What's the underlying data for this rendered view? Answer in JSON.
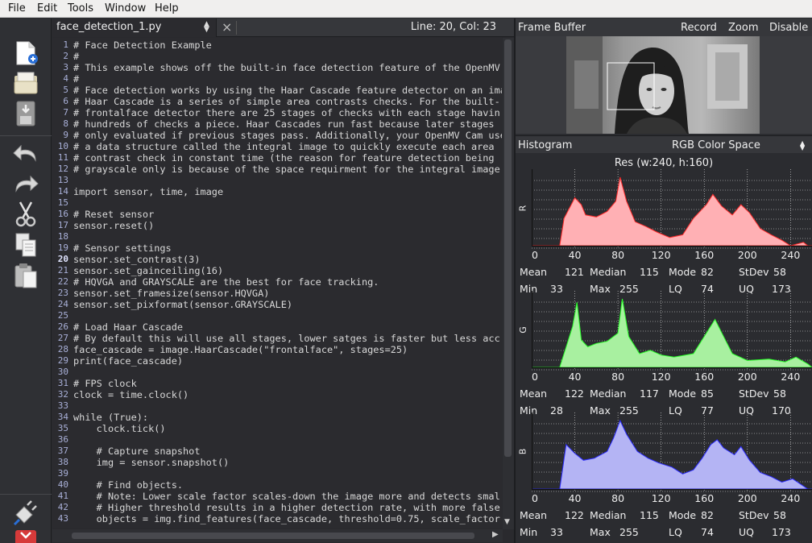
{
  "menu": [
    "File",
    "Edit",
    "Tools",
    "Window",
    "Help"
  ],
  "editor": {
    "filename": "face_detection_1.py",
    "cursor": "Line: 20, Col: 23",
    "current_line": 20,
    "lines": [
      "# Face Detection Example",
      "#",
      "# This example shows off the built-in face detection feature of the OpenMV",
      "#",
      "# Face detection works by using the Haar Cascade feature detector on an ima",
      "# Haar Cascade is a series of simple area contrasts checks. For the built-",
      "# frontalface detector there are 25 stages of checks with each stage havin",
      "# hundreds of checks a piece. Haar Cascades run fast because later stages",
      "# only evaluated if previous stages pass. Additionally, your OpenMV Cam use",
      "# a data structure called the integral image to quickly execute each area",
      "# contrast check in constant time (the reason for feature detection being",
      "# grayscale only is because of the space requirment for the integral image",
      "",
      "import sensor, time, image",
      "",
      "# Reset sensor",
      "sensor.reset()",
      "",
      "# Sensor settings",
      "sensor.set_contrast(3)",
      "sensor.set_gainceiling(16)",
      "# HQVGA and GRAYSCALE are the best for face tracking.",
      "sensor.set_framesize(sensor.HQVGA)",
      "sensor.set_pixformat(sensor.GRAYSCALE)",
      "",
      "# Load Haar Cascade",
      "# By default this will use all stages, lower satges is faster but less acc",
      "face_cascade = image.HaarCascade(\"frontalface\", stages=25)",
      "print(face_cascade)",
      "",
      "# FPS clock",
      "clock = time.clock()",
      "",
      "while (True):",
      "    clock.tick()",
      "",
      "    # Capture snapshot",
      "    img = sensor.snapshot()",
      "",
      "    # Find objects.",
      "    # Note: Lower scale factor scales-down the image more and detects smal",
      "    # Higher threshold results in a higher detection rate, with more false",
      "    objects = img.find_features(face_cascade, threshold=0.75, scale_factor"
    ]
  },
  "framebuffer": {
    "title": "Frame Buffer",
    "buttons": [
      "Record",
      "Zoom",
      "Disable"
    ]
  },
  "histogram": {
    "title": "Histogram",
    "color_space": "RGB Color Space",
    "resolution": "Res (w:240, h:160)",
    "x_ticks": [
      "0",
      "40",
      "80",
      "120",
      "160",
      "200",
      "240"
    ],
    "stat_labels": [
      "Mean",
      "Median",
      "Mode",
      "StDev",
      "Min",
      "Max",
      "LQ",
      "UQ"
    ],
    "channels": [
      {
        "label": "R",
        "color": "#ffb0b4",
        "line": "#ff2a2a",
        "stats": {
          "mean": "121",
          "median": "115",
          "mode": "82",
          "stdev": "58",
          "min": "33",
          "max": "255",
          "lq": "74",
          "uq": "173"
        }
      },
      {
        "label": "G",
        "color": "#a8f0a0",
        "line": "#2aff2a",
        "stats": {
          "mean": "122",
          "median": "117",
          "mode": "85",
          "stdev": "58",
          "min": "28",
          "max": "255",
          "lq": "77",
          "uq": "170"
        }
      },
      {
        "label": "B",
        "color": "#b4b4f4",
        "line": "#2a2aff",
        "stats": {
          "mean": "122",
          "median": "115",
          "mode": "82",
          "stdev": "58",
          "min": "33",
          "max": "255",
          "lq": "74",
          "uq": "173"
        }
      }
    ]
  }
}
